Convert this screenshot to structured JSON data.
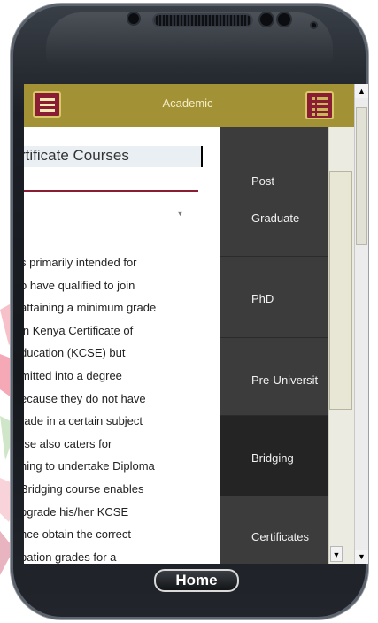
{
  "app": {
    "header_title": "Academic"
  },
  "content": {
    "title": "rtificate Courses",
    "body_lines": [
      "s primarily intended for",
      "o have qualified to join",
      "attaining a minimum grade",
      "in Kenya Certificate of",
      "ducation (KCSE) but",
      "mitted into a degree",
      "ecause they do not have",
      "rade in a certain subject",
      "rse also caters for",
      "hing to undertake Diploma",
      "Bridging course enables",
      "pgrade his/her KCSE",
      "nce obtain the correct",
      "pation grades for a"
    ]
  },
  "side_menu": {
    "items": [
      {
        "line1": "Post",
        "line2": "Graduate"
      },
      {
        "line1": "PhD"
      },
      {
        "line1": "Pre-Universit"
      },
      {
        "line1": "Bridging"
      },
      {
        "line1": "Certificates"
      }
    ]
  },
  "device": {
    "home_label": "Home"
  },
  "colors": {
    "header": "#a39235",
    "button": "#8a1c33",
    "side_panel": "#3c3c3c",
    "side_active": "#242424"
  }
}
